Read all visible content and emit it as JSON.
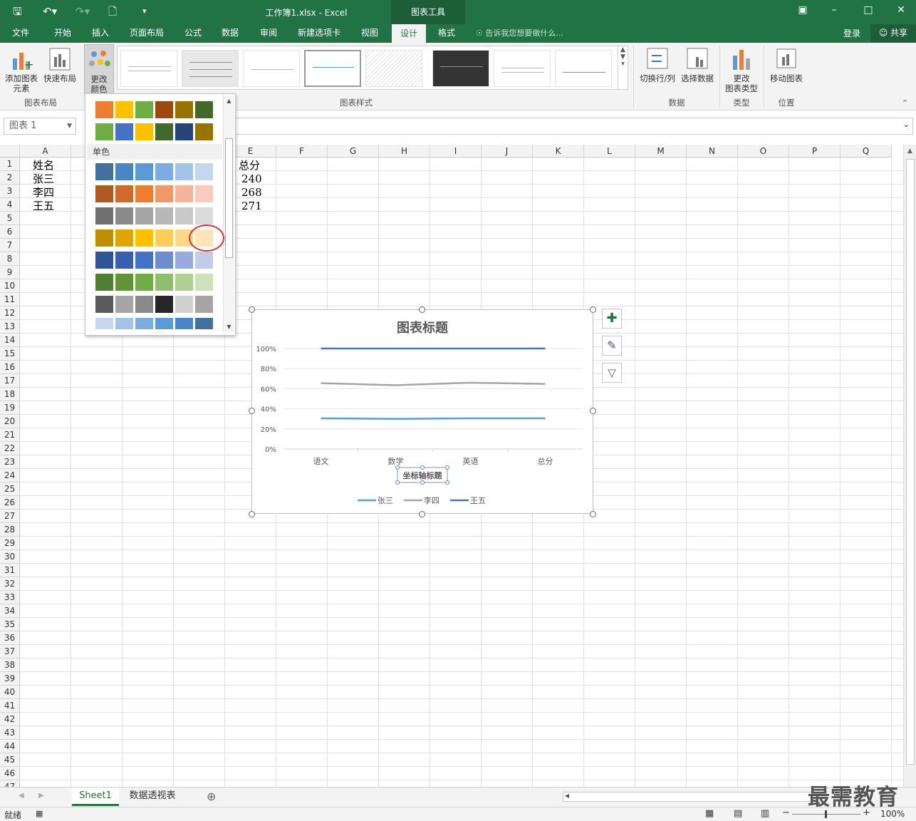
{
  "window": {
    "doc_title": "工作簿1.xlsx - Excel",
    "tools_tab": "图表工具"
  },
  "tabs": [
    {
      "label": "文件"
    },
    {
      "label": "开始"
    },
    {
      "label": "插入"
    },
    {
      "label": "页面布局"
    },
    {
      "label": "公式"
    },
    {
      "label": "数据"
    },
    {
      "label": "审阅"
    },
    {
      "label": "新建选项卡"
    },
    {
      "label": "视图"
    },
    {
      "label": "设计"
    },
    {
      "label": "格式"
    }
  ],
  "tell_me": "告诉我您想要做什么...",
  "login": "登录",
  "share": "共享",
  "ribbon": {
    "add_element": "添加图表\n元素",
    "quick_layout": "快速布局",
    "change_color": "更改\n颜色",
    "group_layout": "图表布局",
    "group_styles": "图表样式",
    "switch_rowcol": "切换行/列",
    "select_data": "选择数据",
    "group_data": "数据",
    "change_type": "更改\n图表类型",
    "group_type": "类型",
    "move_chart": "移动图表",
    "group_location": "位置"
  },
  "namebox": "图表 1",
  "columns": [
    "A",
    "B",
    "C",
    "D",
    "E",
    "F",
    "G",
    "H",
    "I",
    "J",
    "K",
    "L",
    "M",
    "N",
    "O",
    "P",
    "Q"
  ],
  "cells": {
    "a1": "姓名",
    "a2": "张三",
    "a3": "李四",
    "a4": "王五",
    "e1": "总分",
    "e2": "240",
    "e3": "268",
    "e4": "271"
  },
  "color_panel": {
    "mono_label": "单色",
    "colorful_rows": [
      [
        "#ed7d31",
        "#ffc000",
        "#70ad47",
        "#9e480e",
        "#997300",
        "#43682b"
      ],
      [
        "#70ad47",
        "#4472c4",
        "#ffc000",
        "#43682b",
        "#264478",
        "#997300"
      ]
    ],
    "mono_rows": [
      [
        "#41719c",
        "#4a86c6",
        "#5b9bd5",
        "#7dacde",
        "#a3c3e8",
        "#c5d7ef"
      ],
      [
        "#ae5a21",
        "#d0692a",
        "#ed7d31",
        "#f1986a",
        "#f5b59a",
        "#f8cbbe"
      ],
      [
        "#6f6f6f",
        "#8a8a8a",
        "#a5a5a5",
        "#b7b7b7",
        "#c9c9c9",
        "#dbdbdb"
      ],
      [
        "#bf8f00",
        "#e0a600",
        "#ffc000",
        "#ffcd57",
        "#ffd98a",
        "#ffe5b8"
      ],
      [
        "#2f5597",
        "#3a5fae",
        "#4472c4",
        "#6e8dd0",
        "#98abdc",
        "#c2cce8"
      ],
      [
        "#507e32",
        "#609438",
        "#70ad47",
        "#8fbf6c",
        "#aed192",
        "#cde2bc"
      ],
      [
        "#5a5a5a",
        "#a5a5a5",
        "#8a8a8a",
        "#262626",
        "#d0d0d0",
        "#a5a5a5"
      ],
      [
        "#c5d7ef",
        "#a3c3e8",
        "#7dacde",
        "#5b9bd5",
        "#4a86c6",
        "#41719c"
      ]
    ]
  },
  "chart_data": {
    "type": "line",
    "title": "图表标题",
    "categories": [
      "语文",
      "数学",
      "英语",
      "总分"
    ],
    "y_ticks": [
      "0%",
      "20%",
      "40%",
      "60%",
      "80%",
      "100%"
    ],
    "ylim": [
      0,
      1
    ],
    "xlabel": "坐标轴标题",
    "legend_placement": "bottom",
    "series": [
      {
        "name": "张三",
        "color": "#5b9bd5",
        "values": [
          0.305,
          0.3,
          0.305,
          0.305
        ]
      },
      {
        "name": "李四",
        "color": "#a5a5a5",
        "values": [
          0.655,
          0.635,
          0.66,
          0.648
        ]
      },
      {
        "name": "王五",
        "color": "#4472c4",
        "values": [
          1.0,
          1.0,
          1.0,
          1.0
        ]
      }
    ]
  },
  "sheets": [
    {
      "label": "Sheet1"
    },
    {
      "label": "数据透视表"
    }
  ],
  "status": {
    "ready": "就绪",
    "zoom": "100%"
  },
  "watermark": "最需教育"
}
